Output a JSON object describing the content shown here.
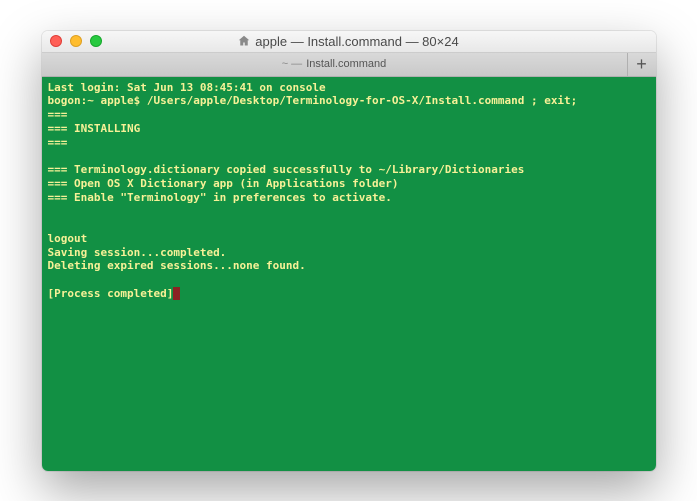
{
  "window": {
    "title": "apple — Install.command — 80×24"
  },
  "tab": {
    "prefix": "~ —",
    "label": "Install.command"
  },
  "terminal": {
    "lines": [
      "Last login: Sat Jun 13 08:45:41 on console",
      "bogon:~ apple$ /Users/apple/Desktop/Terminology-for-OS-X/Install.command ; exit;",
      "===",
      "=== INSTALLING",
      "===",
      "",
      "=== Terminology.dictionary copied successfully to ~/Library/Dictionaries",
      "=== Open OS X Dictionary app (in Applications folder)",
      "=== Enable \"Terminology\" in preferences to activate.",
      "",
      "",
      "logout",
      "Saving session...completed.",
      "Deleting expired sessions...none found."
    ],
    "final": "[Process completed]"
  }
}
